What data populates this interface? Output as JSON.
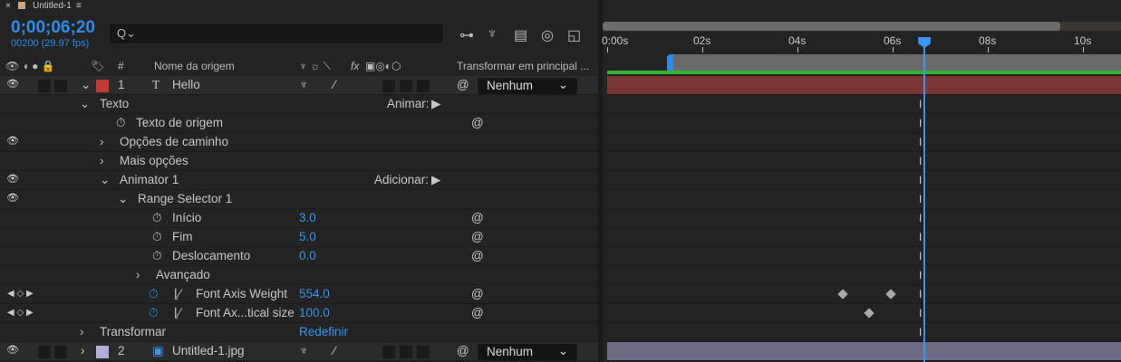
{
  "tab": {
    "close": "×",
    "title": "Untitled-1",
    "menu": "≡"
  },
  "timecode": "0;00;06;20",
  "frame_info": "00200 (29.97 fps)",
  "search": {
    "icon": "Q⌄",
    "placeholder": ""
  },
  "toolbar_icons": [
    "composition-flowchart-icon",
    "shy-layers-icon",
    "frame-blending-icon",
    "motion-blur-icon",
    "graph-editor-icon"
  ],
  "header": {
    "hash": "#",
    "source_name": "Nome da origem",
    "fx": "fx",
    "parent": "Transformar em principal ..."
  },
  "rows": [
    {
      "type": "layer",
      "num": "1",
      "icon": "T",
      "name": "Hello",
      "color": "#c03a3a",
      "parent": "Nenhum"
    },
    {
      "type": "group",
      "name": "Texto",
      "action": "Animar:"
    },
    {
      "type": "prop",
      "name": "Texto de origem"
    },
    {
      "type": "group",
      "name": "Opções de caminho",
      "eye": true
    },
    {
      "type": "group",
      "name": "Mais opções"
    },
    {
      "type": "group",
      "name": "Animator 1",
      "action": "Adicionar:",
      "eye": true
    },
    {
      "type": "group",
      "name": "Range Selector 1",
      "eye": true
    },
    {
      "type": "prop",
      "name": "Início",
      "value": "3.0"
    },
    {
      "type": "prop",
      "name": "Fim",
      "value": "5.0"
    },
    {
      "type": "prop",
      "name": "Deslocamento",
      "value": "0.0"
    },
    {
      "type": "group",
      "name": "Avançado"
    },
    {
      "type": "prop",
      "name": "Font Axis Weight",
      "value": "554.0"
    },
    {
      "type": "prop",
      "name": "Font Ax...tical size",
      "value": "100.0"
    },
    {
      "type": "group",
      "name": "Transformar",
      "value": "Redefinir"
    },
    {
      "type": "layer",
      "num": "2",
      "icon": "img",
      "name": "Untitled-1.jpg",
      "color": "#b0aed6",
      "parent": "Nenhum"
    }
  ],
  "ruler": {
    "labels": [
      "0:00s",
      "02s",
      "04s",
      "06s",
      "08s",
      "10s"
    ],
    "seconds": [
      0,
      2,
      4,
      6,
      8,
      10
    ]
  },
  "playhead_seconds": 6.67,
  "work_area_start_seconds": 1.33,
  "keyframes": {
    "font_axis_weight": [
      4.95,
      5.96
    ],
    "font_axis_optical_size": [
      5.5
    ]
  },
  "colors": {
    "accent": "#3a94f0",
    "layer1_bar": "#7a3535",
    "layer2_bar": "#6c6a85",
    "work_area": "#31b531"
  }
}
